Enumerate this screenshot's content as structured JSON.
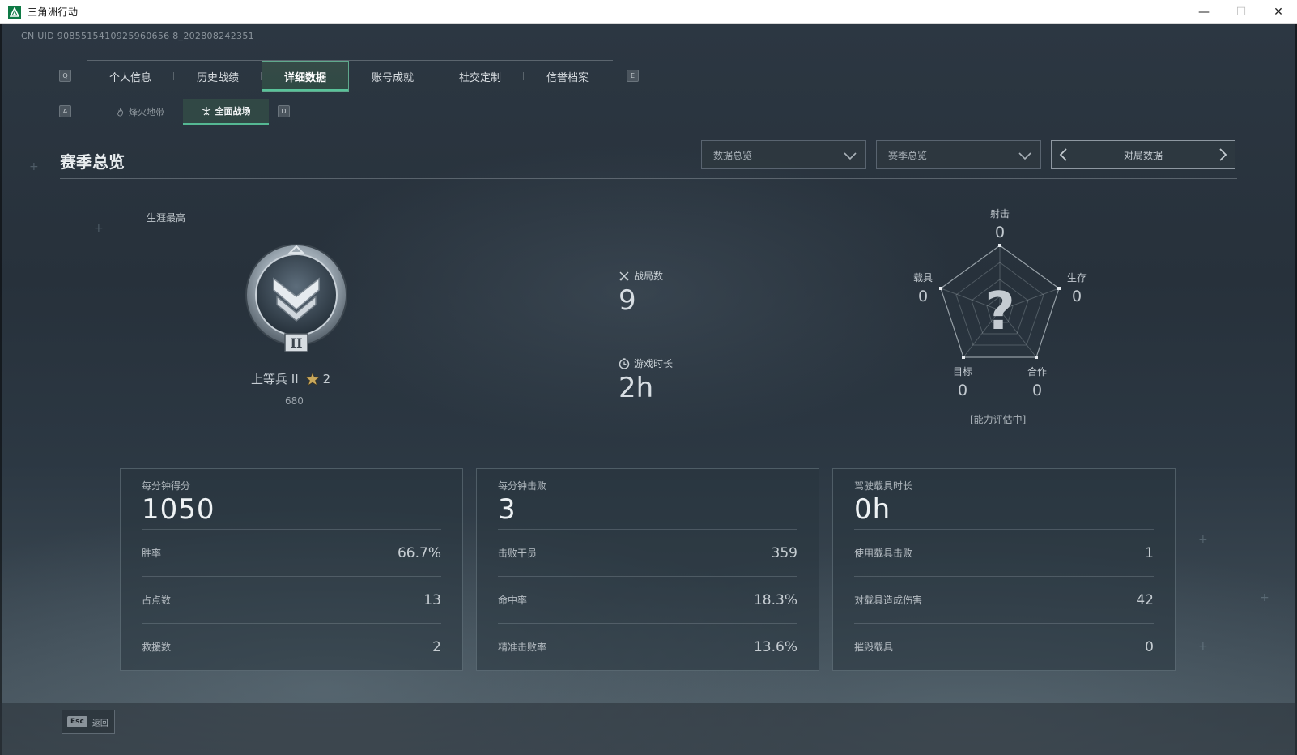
{
  "window": {
    "title": "三角洲行动",
    "minimize": "—",
    "maximize": "☐",
    "close": "✕"
  },
  "uid": "CN UID 9085515410925960656 8_202808242351",
  "keys": {
    "prev_tab": "Q",
    "next_tab": "E",
    "prev_mode": "A",
    "next_mode": "D"
  },
  "tabs": [
    {
      "label": "个人信息",
      "active": false
    },
    {
      "label": "历史战绩",
      "active": false
    },
    {
      "label": "详细数据",
      "active": true
    },
    {
      "label": "账号成就",
      "active": false
    },
    {
      "label": "社交定制",
      "active": false
    },
    {
      "label": "信誉档案",
      "active": false
    }
  ],
  "modes": [
    {
      "label": "烽火地带",
      "active": false,
      "icon": "flame-icon"
    },
    {
      "label": "全面战场",
      "active": true,
      "icon": "crosshair-icon"
    }
  ],
  "section_title": "赛季总览",
  "filters": {
    "data_overview": "数据总览",
    "season_overview": "赛季总览",
    "pager_label": "对局数据"
  },
  "career": {
    "label": "生涯最高",
    "rank_name": "上等兵 II",
    "stars": "2",
    "score": "680",
    "badge_numeral": "II"
  },
  "mid_stats": {
    "battles_label": "战局数",
    "battles_value": "9",
    "playtime_label": "游戏时长",
    "playtime_value": "2h"
  },
  "radar": {
    "axes": [
      {
        "label": "射击",
        "value": "0"
      },
      {
        "label": "生存",
        "value": "0"
      },
      {
        "label": "合作",
        "value": "0"
      },
      {
        "label": "目标",
        "value": "0"
      },
      {
        "label": "载具",
        "value": "0"
      }
    ],
    "center_mark": "?",
    "evaluation": "[能力评估中]"
  },
  "cards": [
    {
      "head_label": "每分钟得分",
      "head_value": "1050",
      "rows": [
        {
          "label": "胜率",
          "value": "66.7%"
        },
        {
          "label": "占点数",
          "value": "13"
        },
        {
          "label": "救援数",
          "value": "2"
        }
      ]
    },
    {
      "head_label": "每分钟击败",
      "head_value": "3",
      "rows": [
        {
          "label": "击败干员",
          "value": "359"
        },
        {
          "label": "命中率",
          "value": "18.3%"
        },
        {
          "label": "精准击败率",
          "value": "13.6%"
        }
      ]
    },
    {
      "head_label": "驾驶载具时长",
      "head_value": "0h",
      "rows": [
        {
          "label": "使用载具击败",
          "value": "1"
        },
        {
          "label": "对载具造成伤害",
          "value": "42"
        },
        {
          "label": "摧毁载具",
          "value": "0"
        }
      ]
    }
  ],
  "footer": {
    "esc_key": "Esc",
    "back_label": "返回"
  },
  "colors": {
    "accent": "#59c39a",
    "active_tab_bg": "#2f4a44"
  }
}
